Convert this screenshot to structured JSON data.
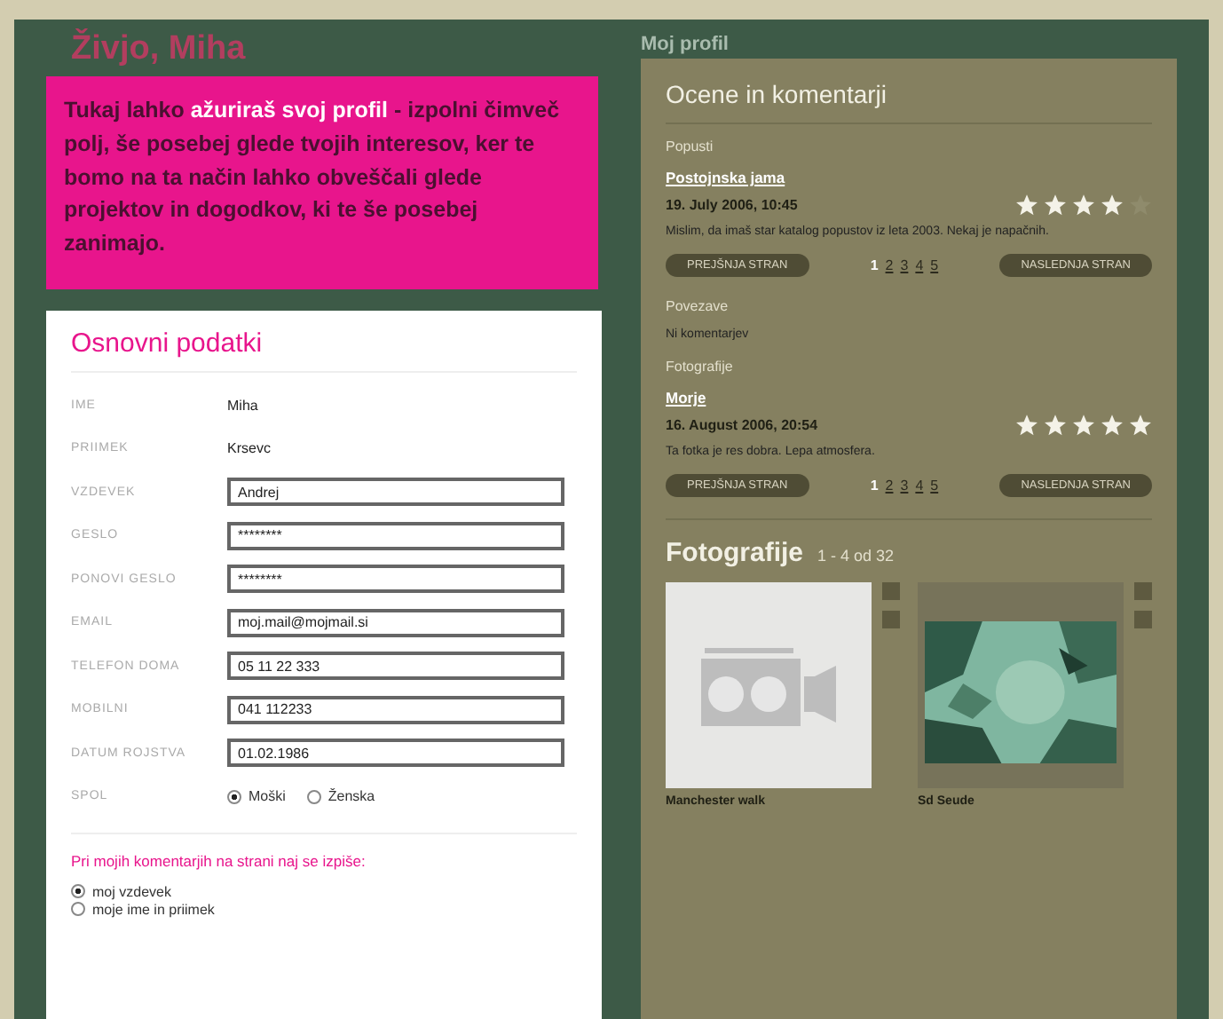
{
  "greeting": "Živjo, Miha",
  "intro": "Tukaj lahko **ažuriraš svoj profil** - izpolni čimveč polj, še posebej glede tvojih interesov, ker te bomo na ta način lahko obveščali glede projektov in dogodkov, ki te še posebej zanimajo.",
  "profile": {
    "title": "Osnovni podatki",
    "fields": [
      {
        "kind": "text",
        "label": "IME",
        "value": "Miha"
      },
      {
        "kind": "text",
        "label": "PRIIMEK",
        "value": "Krsevc"
      },
      {
        "kind": "input",
        "label": "VZDEVEK",
        "value": "Andrej"
      },
      {
        "kind": "input",
        "label": "GESLO",
        "value": "********"
      },
      {
        "kind": "input",
        "label": "PONOVI GESLO",
        "value": "********"
      },
      {
        "kind": "input",
        "label": "EMAIL",
        "value": "moj.mail@mojmail.si"
      },
      {
        "kind": "input",
        "label": "TELEFON DOMA",
        "value": "05 11 22 333"
      },
      {
        "kind": "input",
        "label": "MOBILNI",
        "value": "041 112233"
      },
      {
        "kind": "input",
        "label": "DATUM ROJSTVA",
        "value": "01.02.1986"
      },
      {
        "kind": "radio",
        "label": "SPOL",
        "options": [
          {
            "label": "Moški",
            "selected": true
          },
          {
            "label": "Ženska",
            "selected": false
          }
        ]
      }
    ],
    "display_prompt": "Pri mojih komentarjih na strani naj se izpiše:",
    "display_options": [
      {
        "label": "moj vzdevek",
        "selected": true
      },
      {
        "label": "moje ime in priimek",
        "selected": false
      }
    ]
  },
  "right_header": "Moj profil",
  "ratings": {
    "title": "Ocene in komentarji",
    "sections": [
      {
        "heading": "Popusti",
        "items": [
          {
            "link": "Postojnska jama",
            "date": "19. July 2006, 10:45",
            "stars": 4,
            "comment": "Mislim, da imaš star katalog popustov iz leta 2003. Nekaj je napačnih."
          }
        ],
        "pager": {
          "prev": "PREJŠNJA STRAN",
          "next": "NASLEDNJA STRAN",
          "pages": [
            {
              "label": "1",
              "selected": true
            },
            {
              "label": "2",
              "selected": false
            },
            {
              "label": "3",
              "selected": false
            },
            {
              "label": "4",
              "selected": false
            },
            {
              "label": "5",
              "selected": false
            }
          ]
        }
      },
      {
        "heading": "Povezave",
        "empty": "Ni komentarjev"
      },
      {
        "heading": "Fotografije",
        "items": [
          {
            "link": "Morje",
            "date": "16. August 2006, 20:54",
            "stars": 5,
            "comment": "Ta fotka je res dobra. Lepa atmosfera."
          }
        ],
        "pager": {
          "prev": "PREJŠNJA STRAN",
          "next": "NASLEDNJA STRAN",
          "pages": [
            {
              "label": "1",
              "selected": true
            },
            {
              "label": "2",
              "selected": false
            },
            {
              "label": "3",
              "selected": false
            },
            {
              "label": "4",
              "selected": false
            },
            {
              "label": "5",
              "selected": false
            }
          ]
        }
      }
    ]
  },
  "photos": {
    "title": "Fotografije",
    "count": "1 - 4 od 32",
    "items": [
      {
        "kind": "placeholder",
        "caption": "Manchester walk"
      },
      {
        "kind": "picture",
        "caption": "Sd Seude"
      }
    ]
  }
}
